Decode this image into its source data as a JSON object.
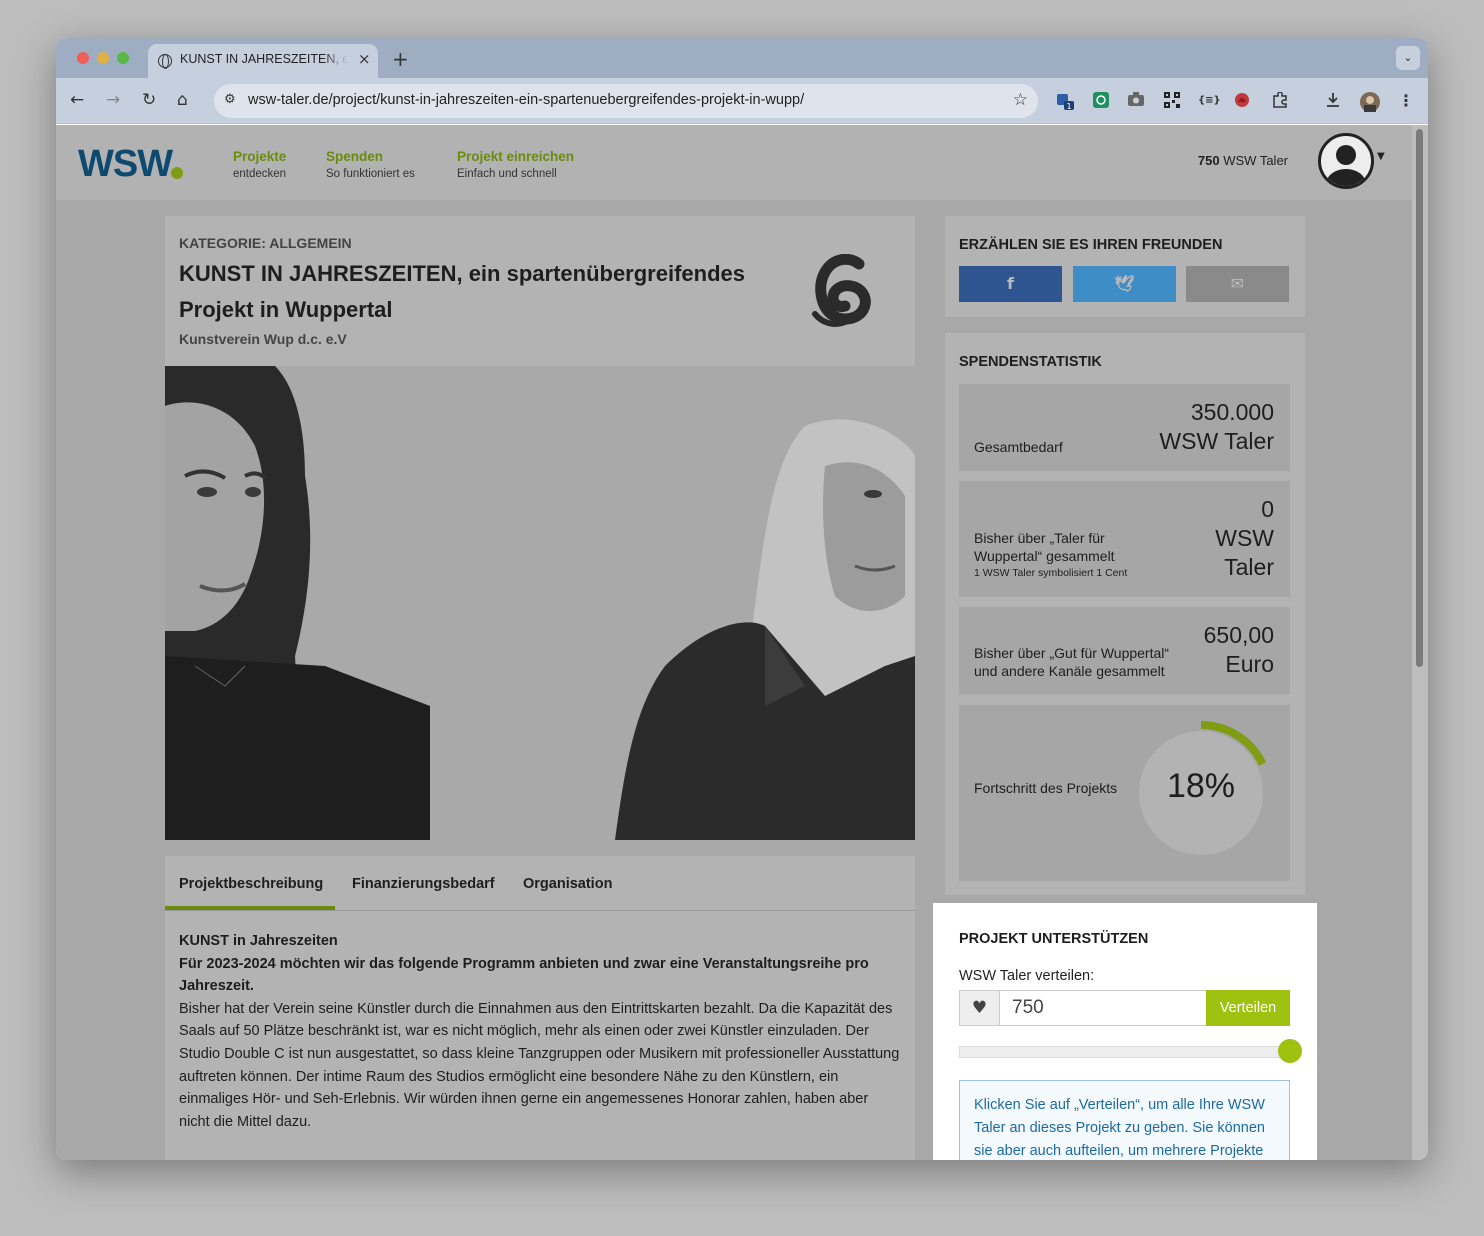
{
  "browser": {
    "tab_title": "KUNST IN JAHRESZEITEN, ein spartenübergreifendes Projekt",
    "url": "wsw-taler.de/project/kunst-in-jahreszeiten-ein-spartenuebergreifendes-projekt-in-wupp/",
    "icons": [
      "back-icon",
      "forward-icon",
      "reload-icon",
      "home-icon",
      "site-settings-icon",
      "bookmark-star-icon",
      "extensions-icon",
      "download-icon",
      "menu-icon"
    ],
    "extension_badge": "1"
  },
  "header": {
    "logo": "WSW",
    "nav": [
      {
        "title": "Projekte",
        "sub": "entdecken"
      },
      {
        "title": "Spenden",
        "sub": "So funktioniert es"
      },
      {
        "title": "Projekt einreichen",
        "sub": "Einfach und schnell"
      }
    ],
    "balance_amount": "750",
    "balance_unit": "WSW Taler"
  },
  "project": {
    "category": "KATEGORIE: ALLGEMEIN",
    "title": "KUNST IN JAHRESZEITEN, ein spartenübergreifendes Projekt in Wuppertal",
    "organization": "Kunstverein Wup d.c. e.V"
  },
  "tabs": [
    "Projektbeschreibung",
    "Finanzierungsbedarf",
    "Organisation"
  ],
  "description": {
    "heading": "KUNST in Jahreszeiten",
    "lead": " Für 2023-2024 möchten wir das folgende Programm anbieten und zwar eine Veranstaltungsreihe pro Jahreszeit.",
    "body": "Bisher hat der Verein seine Künstler durch die Einnahmen aus den Eintrittskarten bezahlt. Da die Kapazität des Saals auf 50 Plätze beschränkt ist, war es nicht möglich, mehr als einen oder zwei Künstler einzuladen. Der Studio Double C ist nun ausgestattet, so dass kleine Tanzgruppen oder Musikern mit professioneller Ausstattung auftreten können. Der intime Raum des Studios ermöglicht eine besondere Nähe zu den Künstlern, ein einmaliges Hör- und Seh-Erlebnis. Wir würden ihnen gerne ein angemessenes Honorar zahlen, haben aber nicht die Mittel dazu."
  },
  "share": {
    "heading": "ERZÄHLEN SIE ES IHREN FREUNDEN",
    "buttons": [
      {
        "name": "facebook-icon",
        "glyph": "f",
        "color": "#2f5590"
      },
      {
        "name": "twitter-icon",
        "glyph": "t",
        "color": "#3f8dc6"
      },
      {
        "name": "mail-icon",
        "glyph": "✉",
        "color": "#8a8a8a"
      }
    ]
  },
  "stats": {
    "heading": "SPENDENSTATISTIK",
    "total_label": "Gesamtbedarf",
    "total_value": "350.000",
    "total_unit": "WSW Taler",
    "taler_label": "Bisher über „Taler für Wuppertal“ gesammelt",
    "taler_note": "1 WSW Taler symbolisiert 1 Cent",
    "taler_value": "0",
    "taler_unit_1": "WSW",
    "taler_unit_2": "Taler",
    "euro_label": "Bisher über „Gut für Wuppertal“ und andere Kanäle gesammelt",
    "euro_value": "650,00",
    "euro_unit": "Euro",
    "progress_label": "Fortschritt des Projekts",
    "progress_text": "18%",
    "progress_fraction": 0.18,
    "accent_color": "#7f9c12"
  },
  "support": {
    "heading": "PROJEKT UNTERSTÜTZEN",
    "label": "WSW Taler verteilen:",
    "amount": "750",
    "button": "Verteilen",
    "slider_fraction": 1.0,
    "info": "Klicken Sie auf „Verteilen“, um alle Ihre WSW Taler an dieses Projekt zu geben. Sie können sie aber auch aufteilen, um mehrere Projekte"
  }
}
